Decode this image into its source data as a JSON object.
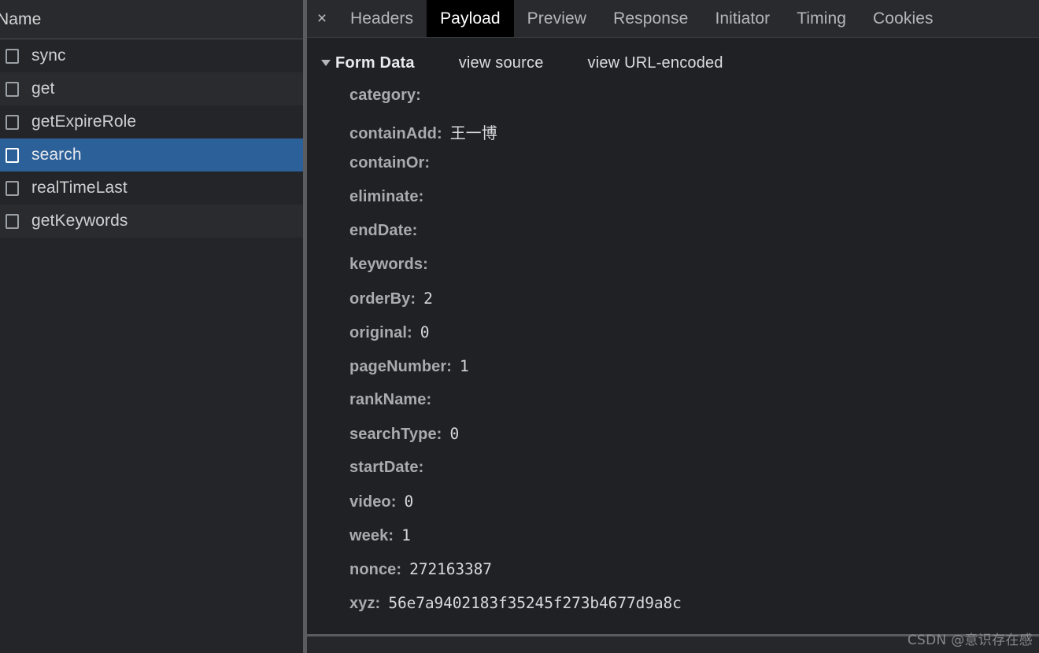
{
  "sidebar": {
    "column_header": "Name",
    "requests": [
      {
        "name": "sync",
        "selected": false
      },
      {
        "name": "get",
        "selected": false
      },
      {
        "name": "getExpireRole",
        "selected": false
      },
      {
        "name": "search",
        "selected": true
      },
      {
        "name": "realTimeLast",
        "selected": false
      },
      {
        "name": "getKeywords",
        "selected": false
      }
    ]
  },
  "tabbar": {
    "close_label": "×",
    "tabs": [
      {
        "label": "Headers",
        "active": false
      },
      {
        "label": "Payload",
        "active": true
      },
      {
        "label": "Preview",
        "active": false
      },
      {
        "label": "Response",
        "active": false
      },
      {
        "label": "Initiator",
        "active": false
      },
      {
        "label": "Timing",
        "active": false
      },
      {
        "label": "Cookies",
        "active": false
      }
    ]
  },
  "payload": {
    "section_title": "Form Data",
    "view_source_label": "view source",
    "view_url_encoded_label": "view URL-encoded",
    "fields": [
      {
        "key": "category:",
        "value": "",
        "cjk": false
      },
      {
        "key": "containAdd:",
        "value": "王一博",
        "cjk": true
      },
      {
        "key": "containOr:",
        "value": "",
        "cjk": false
      },
      {
        "key": "eliminate:",
        "value": "",
        "cjk": false
      },
      {
        "key": "endDate:",
        "value": "",
        "cjk": false
      },
      {
        "key": "keywords:",
        "value": "",
        "cjk": false
      },
      {
        "key": "orderBy:",
        "value": "2",
        "cjk": false
      },
      {
        "key": "original:",
        "value": "0",
        "cjk": false
      },
      {
        "key": "pageNumber:",
        "value": "1",
        "cjk": false
      },
      {
        "key": "rankName:",
        "value": "",
        "cjk": false
      },
      {
        "key": "searchType:",
        "value": "0",
        "cjk": false
      },
      {
        "key": "startDate:",
        "value": "",
        "cjk": false
      },
      {
        "key": "video:",
        "value": "0",
        "cjk": false
      },
      {
        "key": "week:",
        "value": "1",
        "cjk": false
      },
      {
        "key": "nonce:",
        "value": "272163387",
        "cjk": false
      },
      {
        "key": "xyz:",
        "value": "56e7a9402183f35245f273b4677d9a8c",
        "cjk": false
      }
    ]
  },
  "watermark": {
    "text": "CSDN @意识存在感"
  },
  "colors": {
    "selection_blue": "#2c6099",
    "panel_bg": "#202124",
    "list_bg": "#242528",
    "header_bg": "#292a2d",
    "active_tab_bg": "#000000",
    "splitter": "#5a5c60"
  }
}
